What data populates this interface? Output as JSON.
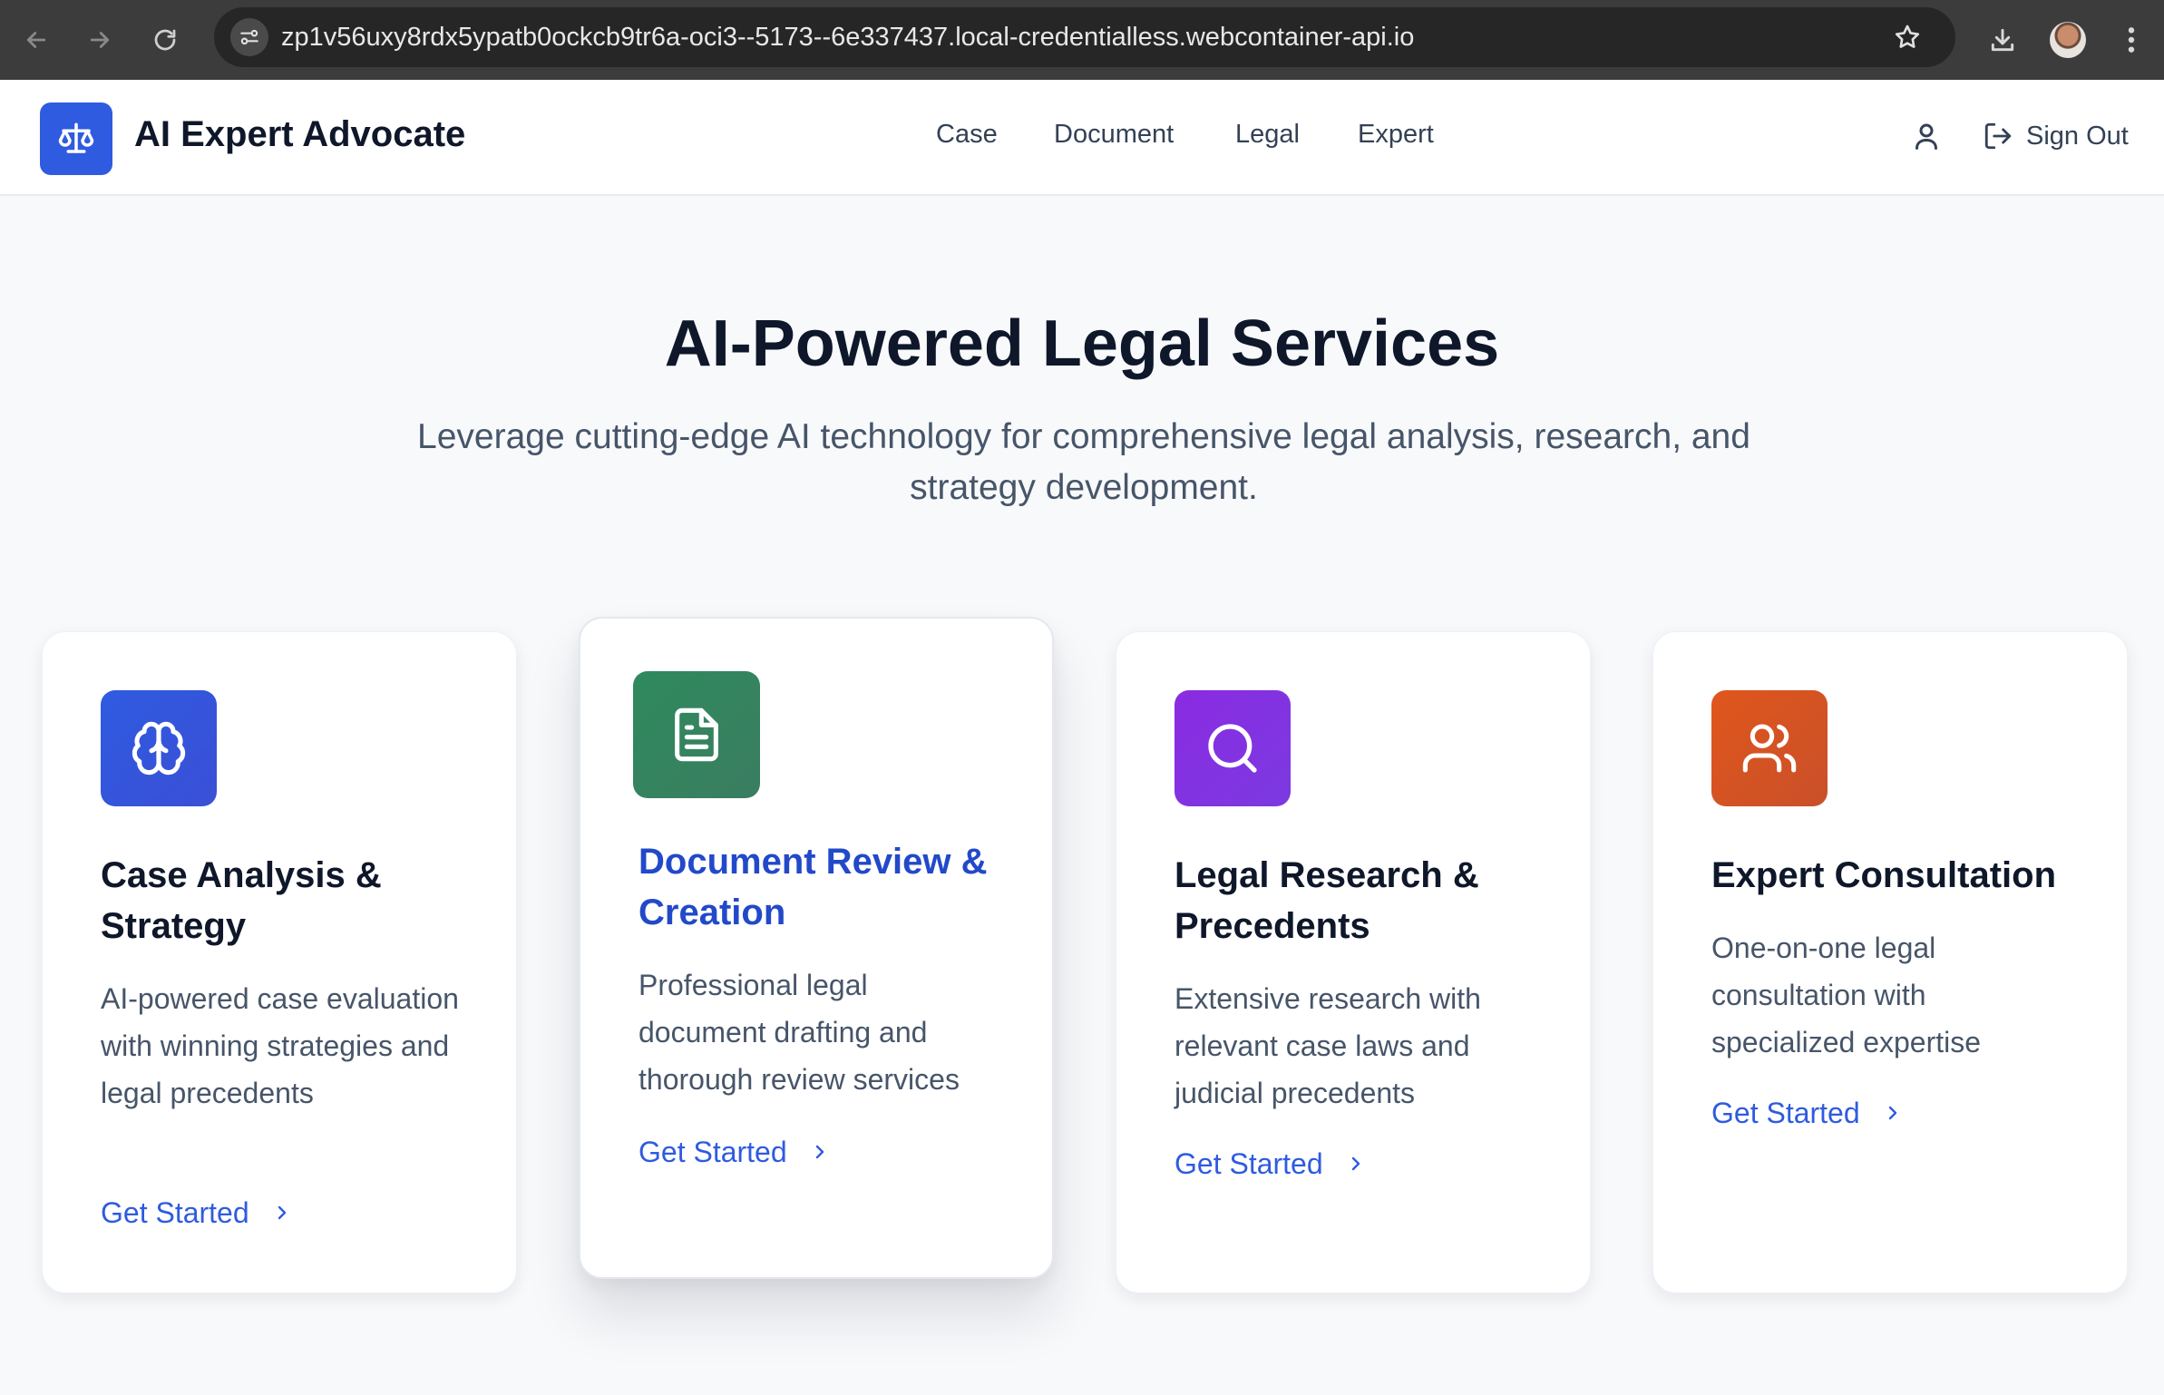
{
  "browser": {
    "url": "zp1v56uxy8rdx5ypatb0ockcb9tr6a-oci3--5173--6e337437.local-credentialless.webcontainer-api.io"
  },
  "header": {
    "brand": "AI Expert Advocate",
    "nav": [
      "Case",
      "Document",
      "Legal",
      "Expert"
    ],
    "sign_out": "Sign Out"
  },
  "hero": {
    "title": "AI-Powered Legal Services",
    "subtitle": "Leverage cutting-edge AI technology for comprehensive legal analysis, research, and strategy development."
  },
  "cards": [
    {
      "icon": "brain-icon",
      "color": "#2f5be0",
      "title": "Case Analysis & Strategy",
      "description": "AI-powered case evaluation with winning strategies and legal precedents",
      "cta": "Get Started"
    },
    {
      "icon": "document-icon",
      "color": "#2f8a5e",
      "title": "Document Review & Creation",
      "description": "Professional legal document drafting and thorough review services",
      "cta": "Get Started"
    },
    {
      "icon": "search-icon",
      "color": "#8a2be2",
      "title": "Legal Research & Precedents",
      "description": "Extensive research with relevant case laws and judicial precedents",
      "cta": "Get Started"
    },
    {
      "icon": "users-icon",
      "color": "#d9541c",
      "title": "Expert Consultation",
      "description": "One-on-one legal consultation with specialized expertise",
      "cta": "Get Started"
    }
  ]
}
